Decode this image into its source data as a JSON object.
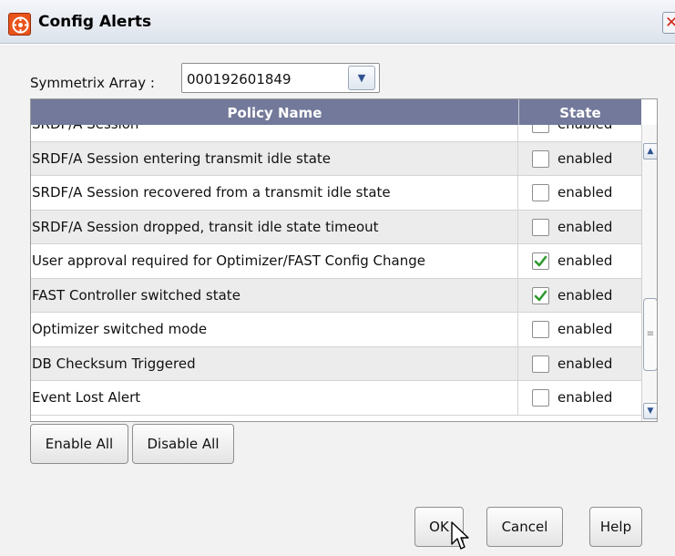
{
  "window": {
    "title": "Config Alerts",
    "close_glyph": "✕",
    "title_icon": "alert-config-icon"
  },
  "symmetrix": {
    "label": "Symmetrix Array :",
    "value": "000192601849"
  },
  "table": {
    "columns": [
      "Policy Name",
      "State"
    ],
    "rows": [
      {
        "name": "SRDF/A Session",
        "state": "enabled",
        "checked": false
      },
      {
        "name": "SRDF/A Session entering transmit idle state",
        "state": "enabled",
        "checked": false
      },
      {
        "name": "SRDF/A Session recovered from a transmit idle state",
        "state": "enabled",
        "checked": false
      },
      {
        "name": "SRDF/A Session dropped, transit idle state timeout",
        "state": "enabled",
        "checked": false
      },
      {
        "name": "User approval required for Optimizer/FAST Config Change",
        "state": "enabled",
        "checked": true
      },
      {
        "name": "FAST Controller switched state",
        "state": "enabled",
        "checked": true
      },
      {
        "name": "Optimizer switched mode",
        "state": "enabled",
        "checked": false
      },
      {
        "name": "DB Checksum Triggered",
        "state": "enabled",
        "checked": false
      },
      {
        "name": "Event Lost Alert",
        "state": "enabled",
        "checked": false
      }
    ]
  },
  "scrollbar": {
    "up_glyph": "▲",
    "down_glyph": "▼",
    "thumb_glyph": "≡"
  },
  "buttons": {
    "enable_all": "Enable All",
    "disable_all": "Disable All",
    "ok": "OK",
    "cancel": "Cancel",
    "help": "Help"
  },
  "colors": {
    "header_bg": "#73799a",
    "check_green": "#2e9a2e",
    "close_red": "#d2291a"
  }
}
